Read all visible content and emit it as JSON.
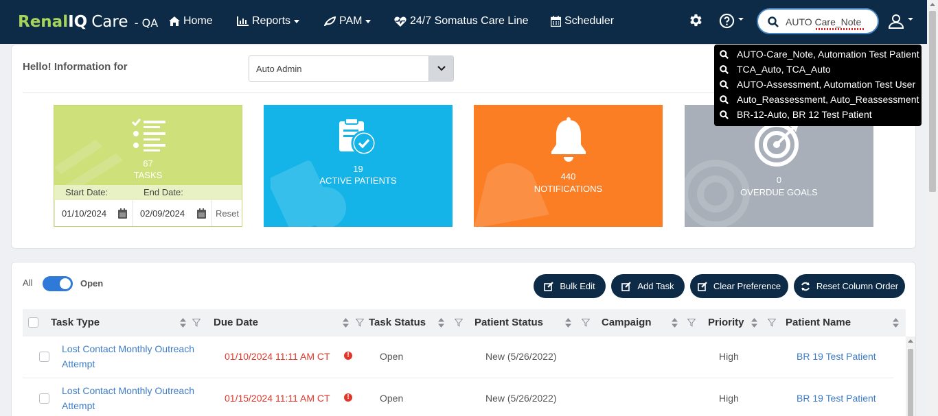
{
  "brand": {
    "part1": "Renal",
    "part2": "IQ",
    "part3": "Care",
    "env": "- QA"
  },
  "nav": {
    "home": "Home",
    "reports": "Reports",
    "pam": "PAM",
    "care_line": "24/7 Somatus Care Line",
    "scheduler": "Scheduler"
  },
  "search": {
    "value": "AUTO Care_Note",
    "icon": "search-icon"
  },
  "suggestions": [
    "AUTO-Care_Note, Automation Test Patient",
    "TCA_Auto, TCA_Auto",
    "AUTO-Assessment, Automation Test User",
    "Auto_Reassessment, Auto_Reassessment",
    "BR-12-Auto, BR 12 Test Patient"
  ],
  "info": {
    "hello": "Hello! Information for",
    "selected_user": "Auto Admin"
  },
  "tiles": {
    "tasks": {
      "value": "67",
      "label": "TASKS",
      "color": "#cde07a"
    },
    "patients": {
      "value": "19",
      "label": "ACTIVE PATIENTS",
      "color": "#14b4e8"
    },
    "notifications": {
      "value": "440",
      "label": "NOTIFICATIONS",
      "color": "#fb7d24"
    },
    "goals": {
      "value": "0",
      "label": "OVERDUE GOALS",
      "color": "#a8afb9"
    }
  },
  "date_filter": {
    "start_label": "Start Date:",
    "end_label": "End Date:",
    "start": "01/10/2024",
    "end": "02/09/2024",
    "reset": "Reset"
  },
  "toggle": {
    "all": "All",
    "open": "Open",
    "state": "open"
  },
  "buttons": {
    "bulk_edit": "Bulk Edit",
    "add_task": "Add Task",
    "clear_pref": "Clear Preference",
    "reset_cols": "Reset Column Order"
  },
  "table": {
    "headers": [
      "Task Type",
      "Due Date",
      "Task Status",
      "Patient Status",
      "Campaign",
      "Priority",
      "Patient Name"
    ],
    "rows": [
      {
        "task_type_1": "Lost Contact Monthly Outreach",
        "task_type_2": "Attempt",
        "due": "01/10/2024 11:11 AM CT",
        "status": "Open",
        "patient_status": "New (5/26/2022)",
        "campaign": "",
        "priority": "High",
        "patient": "BR 19 Test Patient"
      },
      {
        "task_type_1": "Lost Contact Monthly Outreach",
        "task_type_2": "Attempt",
        "due": "01/15/2024 11:11 AM CT",
        "status": "Open",
        "patient_status": "New (5/26/2022)",
        "campaign": "",
        "priority": "High",
        "patient": "BR 19 Test Patient"
      }
    ]
  },
  "colors": {
    "navbar": "#0d2b47",
    "accent_green": "#a8d45a",
    "link": "#3e7cc7",
    "overdue": "#e0362b"
  }
}
